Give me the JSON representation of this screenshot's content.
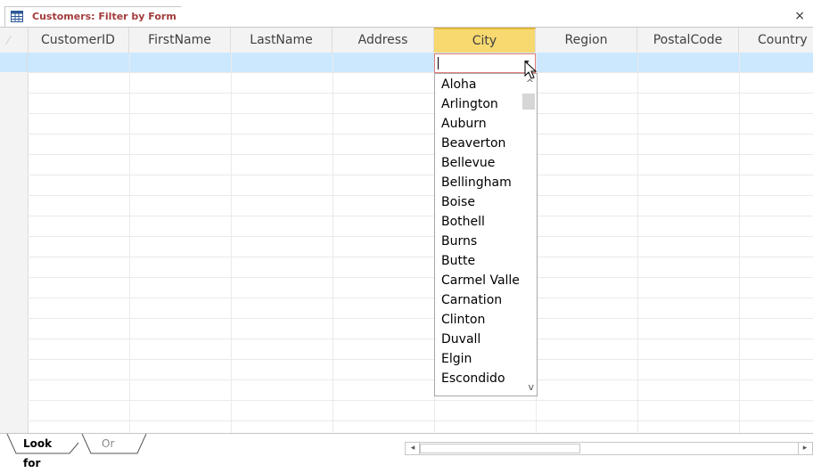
{
  "window": {
    "tab_title": "Customers: Filter by Form",
    "close_glyph": "×"
  },
  "grid": {
    "columns": [
      "CustomerID",
      "FirstName",
      "LastName",
      "Address",
      "City",
      "Region",
      "PostalCode",
      "Country"
    ],
    "active_column": "City",
    "city_value": ""
  },
  "city_dropdown": {
    "options": [
      "Aloha",
      "Arlington",
      "Auburn",
      "Beaverton",
      "Bellevue",
      "Bellingham",
      "Boise",
      "Bothell",
      "Burns",
      "Butte",
      "Carmel Valle",
      "Carnation",
      "Clinton",
      "Duvall",
      "Elgin",
      "Escondido"
    ],
    "scroll_up_glyph": "^",
    "scroll_down_glyph": "v",
    "button_glyph": "▾"
  },
  "bottom_tabs": {
    "look_for": "Look for",
    "or": "Or"
  },
  "scrollbar": {
    "left_glyph": "◂",
    "right_glyph": "▸"
  },
  "colors": {
    "active_column_header": "#f8d970",
    "active_row": "#cce8ff",
    "tab_title": "#a33b3b"
  },
  "icons": [
    "table-icon",
    "close-icon",
    "dropdown-arrow-icon",
    "mouse-pointer-icon"
  ]
}
